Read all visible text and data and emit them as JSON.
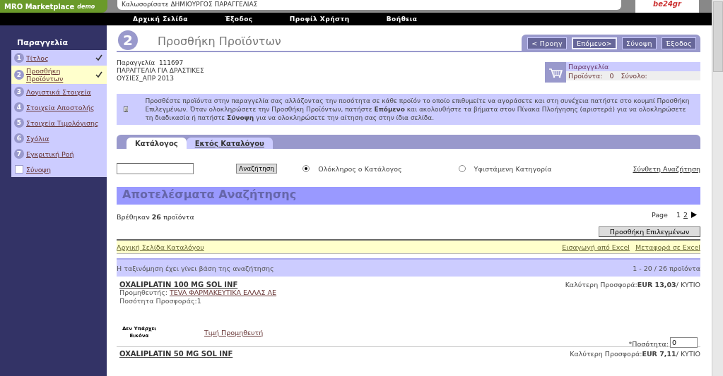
{
  "header": {
    "logo": "MRO Marketplace",
    "logo_sub": "demo",
    "welcome": "Καλωσορίσατε ΔΗΜΙΟΥΡΓΟΣ ΠΑΡΑΓΓΕΛΙΑΣ",
    "partner_logo": "be24gr"
  },
  "nav": [
    "Αρχική Σελίδα",
    "Έξοδος",
    "Προφίλ Χρήστη",
    "Βοήθεια"
  ],
  "sidebar": {
    "title": "Παραγγελία",
    "steps": [
      {
        "kind": "number",
        "number": "1",
        "label": "Τίτλος",
        "checked": true,
        "selected": false
      },
      {
        "kind": "number",
        "number": "2",
        "label": "Προσθήκη Προϊόντων",
        "checked": true,
        "selected": true
      },
      {
        "kind": "number",
        "number": "3",
        "label": "Λογιστικά Στοιχεία",
        "checked": false,
        "selected": false
      },
      {
        "kind": "number",
        "number": "4",
        "label": "Στοιχεία Αποστολής",
        "checked": false,
        "selected": false
      },
      {
        "kind": "number",
        "number": "5",
        "label": "Στοιχεία Τιμολόγισης",
        "checked": false,
        "selected": false
      },
      {
        "kind": "number",
        "number": "6",
        "label": "Σχόλια",
        "checked": false,
        "selected": false
      },
      {
        "kind": "number",
        "number": "7",
        "label": "Εγκριτική Ροή",
        "checked": false,
        "selected": false
      },
      {
        "kind": "square",
        "label": "Σύνοψη",
        "checked": false,
        "selected": false
      }
    ]
  },
  "page": {
    "step": "2",
    "title": "Προσθήκη Προϊόντων",
    "buttons": [
      {
        "label": "< Προηγ",
        "selected": false
      },
      {
        "label": "Επόμενο>",
        "selected": true
      },
      {
        "label": "Σύνοψη",
        "selected": false
      },
      {
        "label": "Έξοδος",
        "selected": false
      }
    ]
  },
  "order": {
    "lines": [
      "Παραγγελία  111697",
      "ΠΑΡΑΓΓΕΛΙΑ ΓΙΑ ΔΡΑΣΤΙΚΕΣ",
      "ΟΥΣΙΕΣ_ΑΠΡ 2013"
    ],
    "cart_title": "Παραγγελία",
    "products_label": "Προϊόντα:",
    "products_value": "0",
    "total_label": "Σύνολο:"
  },
  "info": "Προσθέστε προϊόντα στην παραγγελία σας αλλάζοντας την ποσότητα σε κάθε προϊόν το οποίο επιθυμείτε να αγοράσετε και στη συνέχεια πατήστε στο κουμπί Προσθήκη Επιλεγμένων. Όταν ολοκληρώσετε την Προσθήκη Προϊόντων, πατήστε **Επόμενο** και ακολουθήστε τα βήματα στον Πίνακα Πλοήγησης (αριστερά) για να ολοκληρώσετε τη διαδικασία ή πατήστε **Σύνοψη** για να ολοκληρώσετε την αίτηση σας στην ίδια σελίδα.",
  "tabs": [
    {
      "label": "Κατάλογος",
      "selected": true
    },
    {
      "label": "Εκτός Καταλόγου",
      "selected": false
    }
  ],
  "search": {
    "button": "Αναζήτηση",
    "scopes": [
      {
        "label": "Ολόκληρος ο Κατάλογος",
        "selected": true
      },
      {
        "label": "Υφιστάμενη Κατηγορία",
        "selected": false
      }
    ],
    "advanced": "Σύνθετη Αναζήτηση"
  },
  "results": {
    "title": "Αποτελέσματα Αναζήτησης",
    "found": "Βρέθηκαν **26** προϊόντα",
    "page_label": "Page",
    "pages": [
      {
        "label": "1",
        "selected": true
      },
      {
        "label": "2",
        "selected": false
      }
    ],
    "add_button": "Προσθήκη Επιλεγμένων",
    "catalog_home": "Αρχική Σελίδα Καταλόγου",
    "import": "Εισαγωγή από Excel",
    "export": "Μεταφορά σε Excel",
    "sort_note": "Η ταξινόμηση έχει γίνει βάση της αναζήτησης",
    "range": "1 - 20 / 26 προϊόντα"
  },
  "products": [
    {
      "name": "OXALIPLATIN 100 MG SOL INF",
      "supplier_label": "Προμηθευτής:",
      "supplier": "TEVA ΦΑΡΜΑΚΕΥΤΙΚΑ ΕΛΛΑΣ ΑΕ",
      "offer_qty": "Ποσότητα Προσφοράς:1",
      "offer": "Καλύτερη Προσφορά:**EUR 13,03**/ ΚΥΤΙΟ",
      "no_image": "Δεν Υπάρχει Εικόνα",
      "price_link": "Τιμή Προμηθευτή",
      "qty_label": "*Ποσότητα:",
      "qty": "0"
    },
    {
      "name": "OXALIPLATIN 50 MG SOL INF",
      "offer": "Καλύτερη Προσφορά:**EUR 7,11**/ ΚΥΤΙΟ"
    }
  ]
}
